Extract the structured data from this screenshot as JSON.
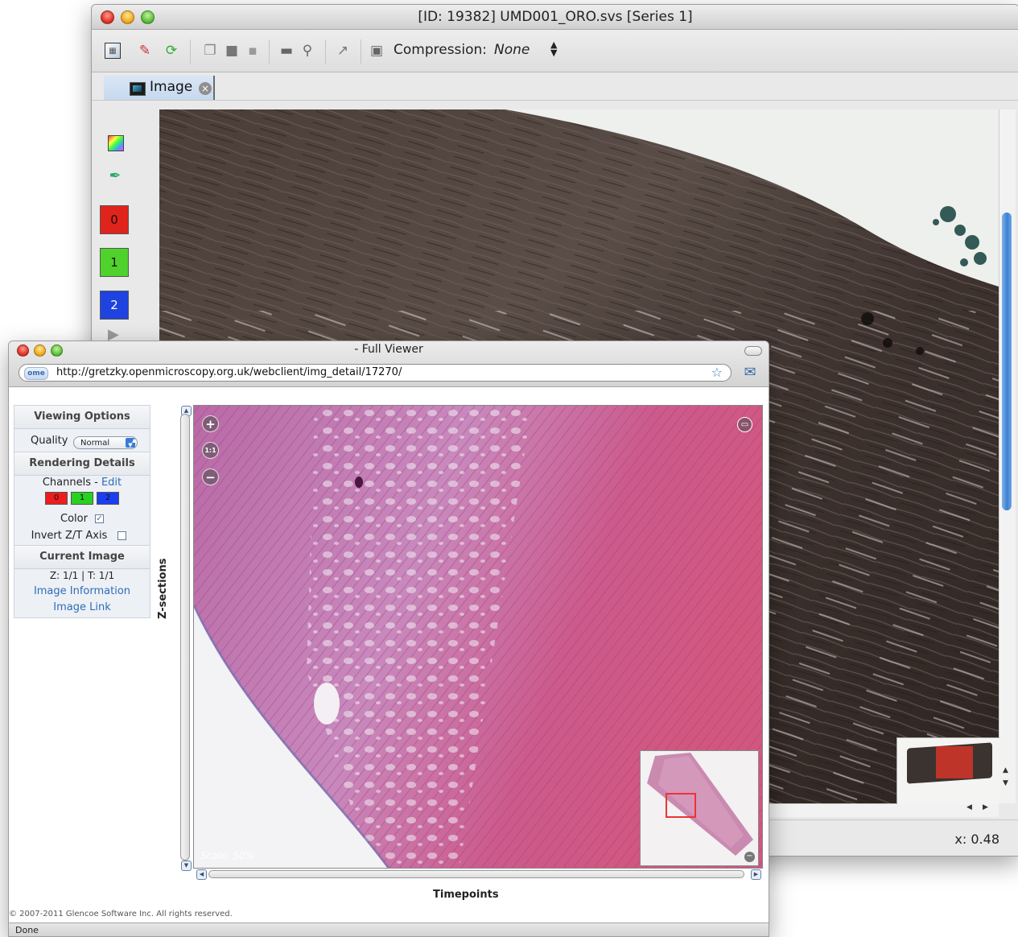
{
  "back_window": {
    "title": "[ID: 19382] UMD001_ORO.svs [Series 1]",
    "toolbar": {
      "compression_label": "Compression:",
      "compression_value": "None"
    },
    "tab": {
      "label": "Image"
    },
    "channels": [
      "0",
      "1",
      "2"
    ],
    "channel_colors": [
      "#e0241b",
      "#4fd22b",
      "#1f43e0"
    ],
    "status_coord": "x: 0.48"
  },
  "front_window": {
    "title": "- Full Viewer",
    "url": "http://gretzky.openmicroscopy.org.uk/webclient/img_detail/17270/",
    "sidebar": {
      "viewing_options": "Viewing Options",
      "quality_label": "Quality",
      "quality_value": "Normal",
      "rendering_details": "Rendering Details",
      "channels_label": "Channels -",
      "edit_link": "Edit",
      "channels": [
        "0",
        "1",
        "2"
      ],
      "color_label": "Color",
      "invert_label": "Invert Z/T Axis",
      "current_image": "Current Image",
      "zt_info": "Z: 1/1 | T: 1/1",
      "image_information": "Image Information",
      "image_link": "Image Link"
    },
    "zsections_label": "Z-sections",
    "timepoints_label": "Timepoints",
    "scale_text": "Scale: 50%",
    "copyright": "© 2007-2011 Glencoe Software Inc. All rights reserved.",
    "status": "Done"
  }
}
